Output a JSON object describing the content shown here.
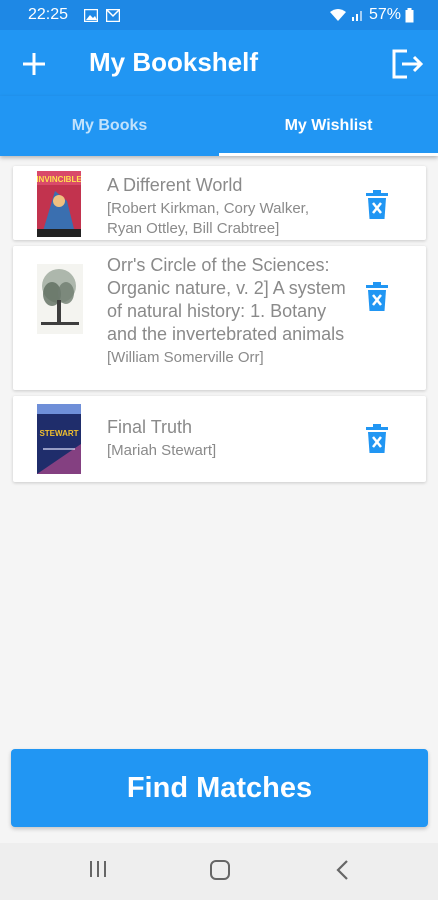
{
  "status_bar": {
    "time": "22:25",
    "battery_percent": "57%",
    "icons": [
      "gallery-icon",
      "mail-icon",
      "wifi-icon",
      "signal-icon",
      "battery-icon"
    ]
  },
  "app_bar": {
    "title": "My Bookshelf",
    "add_icon": "plus-icon",
    "logout_icon": "logout-icon"
  },
  "tabs": [
    {
      "label": "My Books",
      "selected": false
    },
    {
      "label": "My Wishlist",
      "selected": true
    }
  ],
  "books": [
    {
      "title": "A Different World",
      "authors": "[Robert Kirkman, Cory Walker, Ryan Ottley, Bill Crabtree]",
      "cover_text": "INVINCIBLE"
    },
    {
      "title": "Orr's Circle of the Sciences: Organic nature, v. 2] A system of natural history: 1. Botany and the invertebrated animals",
      "authors": "[William Somerville Orr]"
    },
    {
      "title": "Final Truth",
      "authors": "[Mariah Stewart]",
      "cover_text": "STEWART"
    }
  ],
  "find_matches_label": "Find Matches",
  "colors": {
    "primary": "#2196f3",
    "status_bar": "#1e88e5",
    "text_muted": "#8a8a8a"
  },
  "nav_bar": {
    "icons": [
      "recent-apps-icon",
      "home-icon",
      "back-icon"
    ]
  }
}
